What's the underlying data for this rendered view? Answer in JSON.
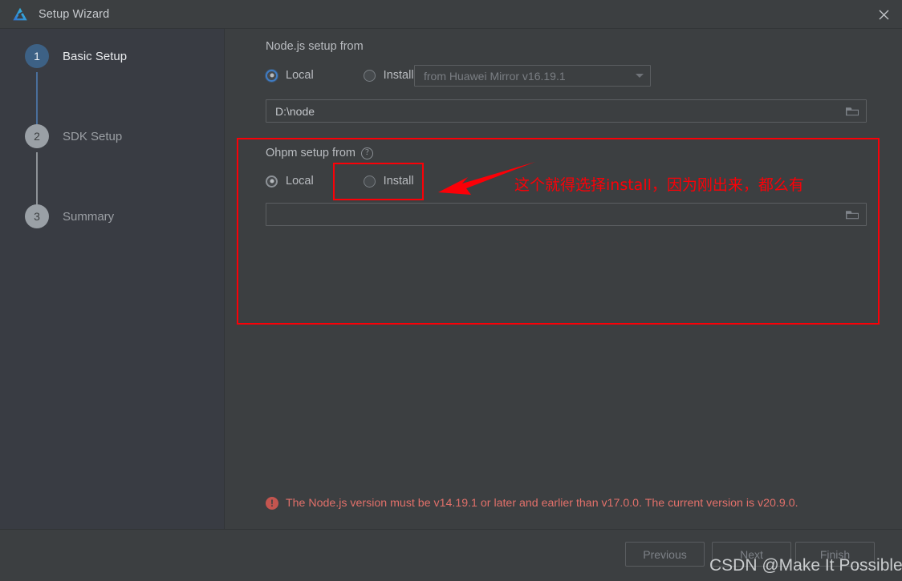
{
  "window": {
    "title": "Setup Wizard",
    "logo_icon": "deveco-studio-logo",
    "close_icon": "close-icon"
  },
  "sidebar": {
    "steps": [
      {
        "number": "1",
        "label": "Basic Setup",
        "state": "active"
      },
      {
        "number": "2",
        "label": "SDK Setup",
        "state": "inactive"
      },
      {
        "number": "3",
        "label": "Summary",
        "state": "inactive"
      }
    ]
  },
  "nodejs": {
    "section_label": "Node.js setup from",
    "radio_local": "Local",
    "radio_install": "Install",
    "selected": "Local",
    "mirror_combo_value": "from Huawei Mirror v16.19.1",
    "path_value": "D:\\node",
    "browse_icon": "folder-icon",
    "caret_icon": "chevron-down-icon"
  },
  "ohpm": {
    "section_label": "Ohpm setup from",
    "help_icon": "help-circle-icon",
    "help_glyph": "?",
    "radio_local": "Local",
    "radio_install": "Install",
    "selected": "Local",
    "path_value": "",
    "path_placeholder": "",
    "browse_icon": "folder-icon"
  },
  "error": {
    "icon": "error-exclamation-icon",
    "icon_glyph": "!",
    "message": "The Node.js version must be v14.19.1 or later and earlier than v17.0.0. The current version is v20.9.0."
  },
  "footer": {
    "previous_label": "Previous",
    "next_label": "Next",
    "finish_label": "Finish"
  },
  "annotation": {
    "color": "#fb0007",
    "text": "这个就得选择install，因为刚出来，都么有",
    "arrow_icon": "left-pointing-arrow-icon"
  },
  "watermark": {
    "text": "CSDN @Make It Possible."
  }
}
